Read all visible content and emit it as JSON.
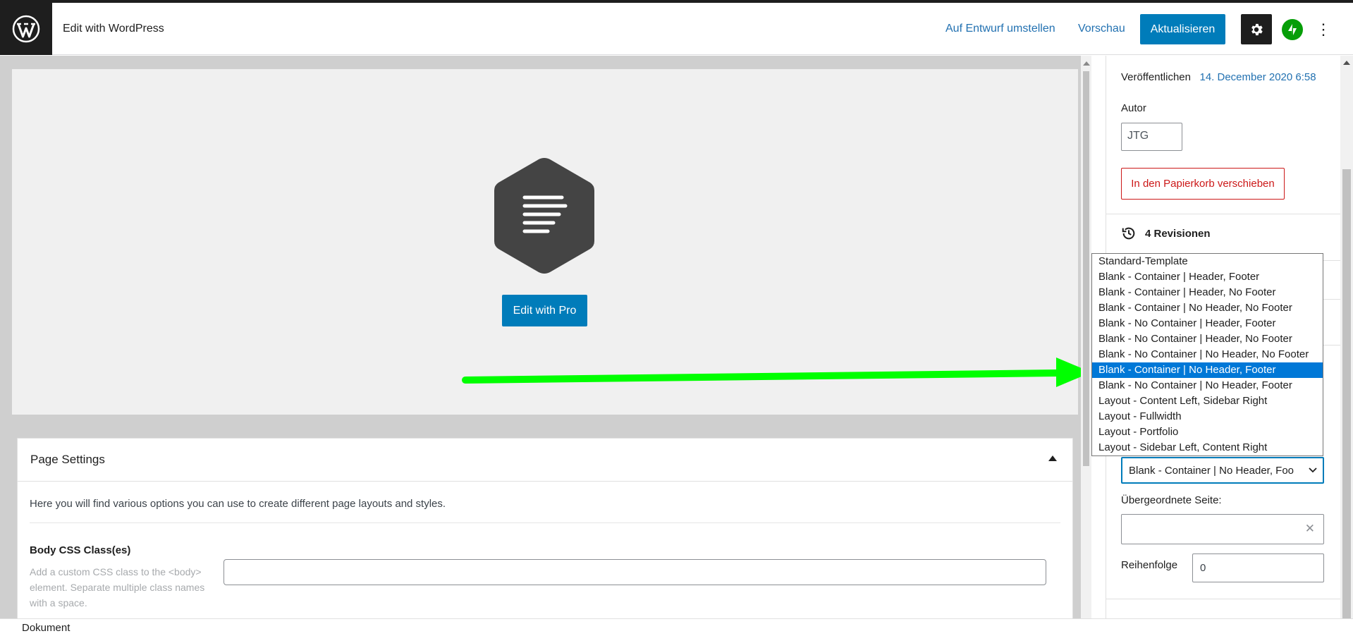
{
  "header": {
    "app_title": "Edit with WordPress",
    "switch_to_draft": "Auf Entwurf umstellen",
    "preview": "Vorschau",
    "update": "Aktualisieren",
    "more": "⋮"
  },
  "builder": {
    "button_label": "Edit with Pro"
  },
  "page_settings": {
    "title": "Page Settings",
    "intro": "Here you will find various options you can use to create different page layouts and styles.",
    "body_css_label": "Body CSS Class(es)",
    "body_css_help": "Add a custom CSS class to the <body> element. Separate multiple class names with a space.",
    "body_css_value": ""
  },
  "sidebar": {
    "publish_label": "Veröffentlichen",
    "publish_date": "14. December 2020 6:58",
    "author_label": "Autor",
    "author_value": "JTG",
    "trash_button": "In den Papierkorb verschieben",
    "revisions": "4 Revisionen",
    "template_selected": "Blank - Container | No Header, Foo",
    "parent_label": "Übergeordnete Seite:",
    "parent_clear": "✕",
    "order_label": "Reihenfolge",
    "order_value": "0"
  },
  "template_options": [
    "Standard-Template",
    "Blank - Container | Header, Footer",
    "Blank - Container | Header, No Footer",
    "Blank - Container | No Header, No Footer",
    "Blank - No Container | Header, Footer",
    "Blank - No Container | Header, No Footer",
    "Blank - No Container | No Header, No Footer",
    "Blank - Container | No Header, Footer",
    "Blank - No Container | No Header, Footer",
    "Layout - Content Left, Sidebar Right",
    "Layout - Fullwidth",
    "Layout - Portfolio",
    "Layout - Sidebar Left, Content Right"
  ],
  "template_selected_index": 7,
  "footer": {
    "breadcrumb": "Dokument"
  },
  "colors": {
    "primary": "#007cba",
    "link": "#2271b1",
    "danger": "#cc1818",
    "annotation_arrow": "#00ff00",
    "jetpack": "#069e08",
    "highlight": "#0078d7"
  },
  "icons": {
    "logo": "wordpress-logo-icon",
    "settings": "gear-icon",
    "jetpack": "jetpack-bolt-icon",
    "revisions": "history-icon",
    "builder": "hexagon-text-icon"
  }
}
